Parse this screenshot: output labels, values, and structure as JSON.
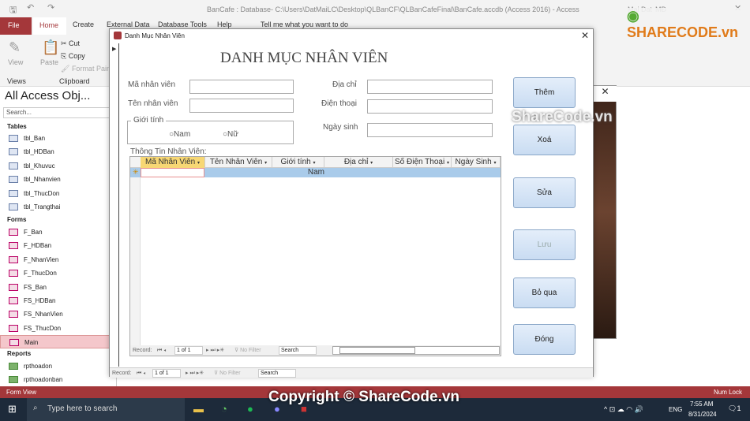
{
  "window": {
    "title": "BanCafe : Database- C:\\Users\\DatMaiLC\\Desktop\\QLBanCF\\QLBanCafeFinal\\BanCafe.accdb (Access 2016)  -  Access",
    "user": "Mai Dat",
    "initials": "MĐ"
  },
  "ribbon": {
    "tabs": [
      "File",
      "Home",
      "Create",
      "External Data",
      "Database Tools",
      "Help",
      "Tell me what you want to do"
    ],
    "view": "View",
    "paste": "Paste",
    "cut": "Cut",
    "copy": "Copy",
    "format_painter": "Format Painter",
    "group_views": "Views",
    "group_clipboard": "Clipboard"
  },
  "nav": {
    "title": "All Access Obj...",
    "search_placeholder": "Search...",
    "tables_label": "Tables",
    "tables": [
      "tbl_Ban",
      "tbl_HDBan",
      "tbl_Khuvuc",
      "tbl_Nhanvien",
      "tbl_ThucDon",
      "tbl_Trangthai"
    ],
    "forms_label": "Forms",
    "forms": [
      "F_Ban",
      "F_HDBan",
      "F_NhanVien",
      "F_ThucDon",
      "FS_Ban",
      "FS_HDBan",
      "FS_NhanVien",
      "FS_ThucDon",
      "Main"
    ],
    "reports_label": "Reports",
    "reports": [
      "rpthoadon",
      "rpthoadonban"
    ]
  },
  "form": {
    "title": "Danh Mục Nhân Viên",
    "heading": "DANH MỤC NHÂN VIÊN",
    "labels": {
      "ma": "Mã nhân viên",
      "ten": "Tên nhân viên",
      "gioitinh": "Giới tính",
      "nam": "Nam",
      "nu": "Nữ",
      "diachi": "Địa chỉ",
      "dienthoai": "Điện thoại",
      "ngaysinh": "Ngày sinh",
      "subform": "Thông Tin Nhân Viên:"
    },
    "buttons": [
      "Thêm",
      "Xoá",
      "Sửa",
      "Lưu",
      "Bỏ qua",
      "Đóng"
    ],
    "grid": {
      "columns": [
        "Mã Nhân Viên",
        "Tên Nhân Viên",
        "Giới tính",
        "Địa chỉ",
        "Số Điện Thoại",
        "Ngày Sinh"
      ],
      "new_row": {
        "gioitinh": "Nam"
      }
    },
    "record_nav": {
      "label": "Record:",
      "position": "1 of 1",
      "filter": "No Filter",
      "search": "Search"
    }
  },
  "status": {
    "left": "Form View",
    "right": "Num Lock"
  },
  "taskbar": {
    "search_placeholder": "Type here to search",
    "lang": "ENG",
    "time": "7:55 AM",
    "date": "8/31/2024",
    "notifications": "1"
  },
  "watermark": {
    "top": "ShareCode.vn",
    "bottom": "Copyright © ShareCode.vn",
    "logo": "SHARECODE.vn"
  }
}
